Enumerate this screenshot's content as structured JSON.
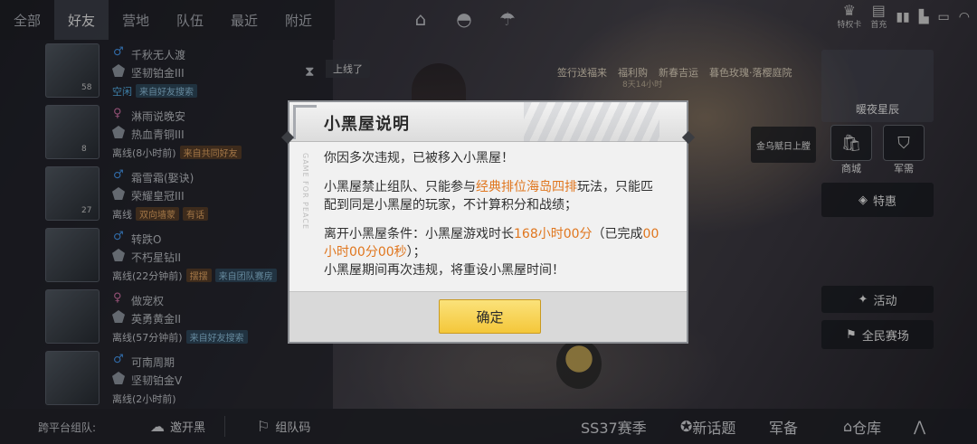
{
  "top_tabs": [
    "全部",
    "好友",
    "营地",
    "队伍",
    "最近",
    "附近"
  ],
  "active_tab_index": 1,
  "status_bar": {
    "badges": [
      {
        "icon": "privilege-card-icon",
        "label": "特权卡"
      },
      {
        "icon": "recharge-icon",
        "label": "首充"
      }
    ]
  },
  "promo": {
    "items": [
      "签行送福来",
      "福利购",
      "新春吉运",
      "暮色玫瑰·落樱庭院"
    ],
    "sub": "8天14小时"
  },
  "friends": [
    {
      "name": "千秋无人渡",
      "gender": "male",
      "rank": "坚韧铂金III",
      "level": "58",
      "state": "空闲",
      "tag": "来自好友搜索",
      "tag_color": "blue",
      "online_state": true
    },
    {
      "name": "淋雨说晚安",
      "gender": "female",
      "rank": "热血青铜III",
      "level": "8",
      "state": "离线(8小时前)",
      "tag": "",
      "tag2": "来自共同好友",
      "tag_color": "orange",
      "online_state": false
    },
    {
      "name": "霜雪霜(娶诀)",
      "gender": "male",
      "rank": "荣耀皇冠III",
      "level": "27",
      "state": "离线",
      "tag": "双向墙蒙",
      "tag2": "有话",
      "tag_color": "orange",
      "online_state": false
    },
    {
      "name": "转跌O",
      "gender": "male",
      "rank": "不朽星钻II",
      "level": "",
      "state": "离线(22分钟前)",
      "tag": "摆摆",
      "tag2": "来自团队赛房",
      "tag_color": "blue",
      "online_state": false
    },
    {
      "name": "做宠权",
      "gender": "female",
      "rank": "英勇黄金II",
      "level": "",
      "state": "离线(57分钟前)",
      "tag": "来自好友搜索",
      "tag_color": "blue",
      "online_state": false
    },
    {
      "name": "可南周期",
      "gender": "male",
      "rank": "坚韧铂金V",
      "level": "",
      "state": "离线(2小时前)",
      "tag": "",
      "tag_color": "blue",
      "online_state": false
    }
  ],
  "online_pill": "上线了",
  "bottom_bar": {
    "cross_platform": "跨平台组队:",
    "wechat_label": "邀开黑",
    "team_code_label": "组队码",
    "season": "SS37赛季",
    "new_topic": "新话题",
    "armory": "军备",
    "warehouse": "仓库"
  },
  "right_panel": {
    "badge_text": "金乌赋日上膛",
    "shop": "商城",
    "army": "军需",
    "special": "特惠",
    "activity": "活动",
    "all_people": "全民赛场",
    "nickname": "暖夜星辰"
  },
  "dialog": {
    "title": "小黑屋说明",
    "side_text": "GAME FOR PEACE",
    "line1": "你因多次违规，已被移入小黑屋！",
    "p2_a": "小黑屋禁止组队、只能参与",
    "p2_hl": "经典排位海岛四排",
    "p2_b": "玩法，只能匹配到同是小黑屋的玩家，不计算积分和战绩；",
    "p3_a": "离开小黑屋条件：小黑屋游戏时长",
    "p3_hl1": "168小时00分",
    "p3_b": "（已完成",
    "p3_hl2": "00小时00分00秒",
    "p3_c": "）；",
    "p3_d": "小黑屋期间再次违规，将重设小黑屋时间！",
    "ok_label": "确定"
  }
}
